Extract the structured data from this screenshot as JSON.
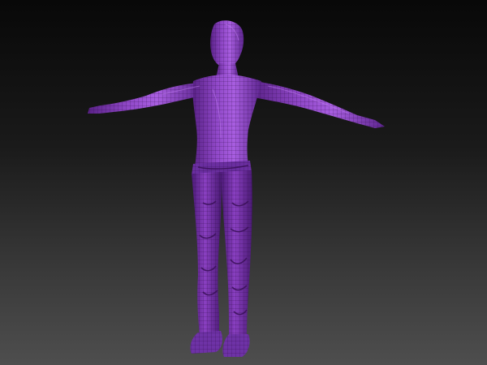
{
  "viewport": {
    "background_top": "#080808",
    "background_bottom": "#4e4e4e"
  },
  "model": {
    "icon": "t-pose-human-mesh",
    "material_color": "#8c3ec4",
    "material_shadow": "#4a1a70",
    "material_highlight": "#b46be6",
    "wireframe_color": "#2a0a40",
    "wireframe_visible": true
  }
}
